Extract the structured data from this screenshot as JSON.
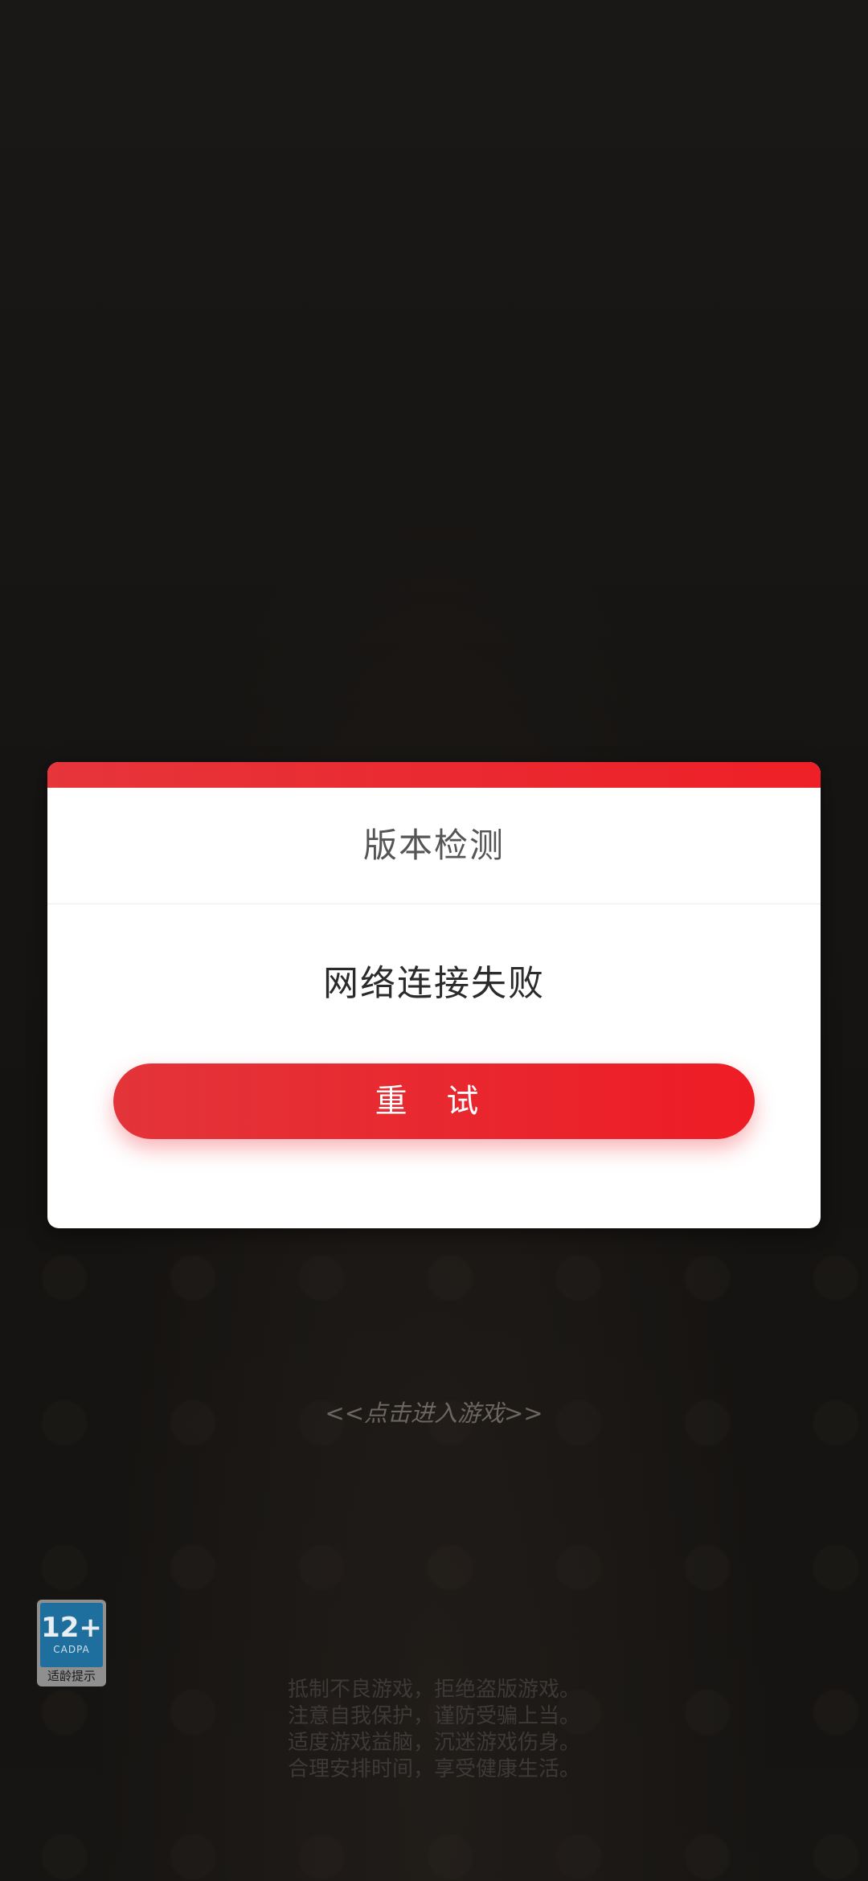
{
  "dialog": {
    "title": "版本检测",
    "message": "网络连接失败",
    "retry_label": "重 试"
  },
  "enter_game_label": "<<点击进入游戏>>",
  "age_badge": {
    "rating": "12+",
    "org": "CADPA",
    "caption": "适龄提示"
  },
  "health_notice": [
    "抵制不良游戏，拒绝盗版游戏。",
    "注意自我保护，谨防受骗上当。",
    "适度游戏益脑，沉迷游戏伤身。",
    "合理安排时间，享受健康生活。"
  ],
  "colors": {
    "accent_red": "#ee1c25",
    "background": "#161412"
  }
}
